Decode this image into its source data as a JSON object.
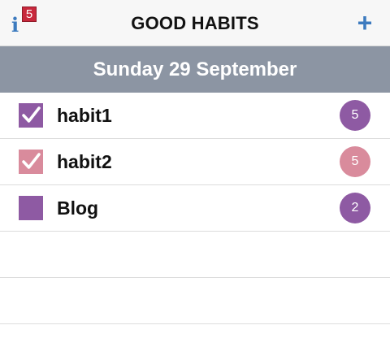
{
  "header": {
    "title": "GOOD HABITS",
    "info_icon": "i",
    "info_badge_count": "5",
    "add_icon": "+"
  },
  "date_bar": {
    "label": "Sunday 29 September"
  },
  "habits": [
    {
      "label": "habit1",
      "count": "5",
      "checked": true,
      "color": "#8e5aa3"
    },
    {
      "label": "habit2",
      "count": "5",
      "checked": true,
      "color": "#d98b9c"
    },
    {
      "label": "Blog",
      "count": "2",
      "checked": false,
      "color": "#8e5aa3"
    }
  ],
  "colors": {
    "accent": "#3d7bbf",
    "badge_red": "#c8283c",
    "date_bar_bg": "#8c95a3"
  }
}
